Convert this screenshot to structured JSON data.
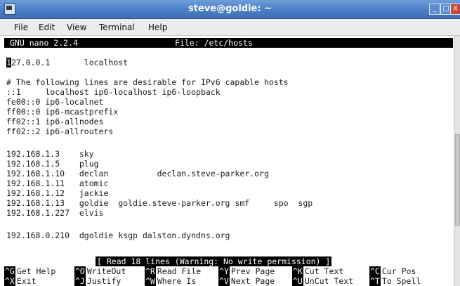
{
  "window": {
    "title": "steve@goldie: ~",
    "buttons": [
      "_",
      "□",
      "X"
    ]
  },
  "menubar": {
    "items": [
      "File",
      "Edit",
      "View",
      "Terminal",
      "Help"
    ]
  },
  "nano": {
    "version": "GNU nano 2.2.4",
    "file_label": "File: /etc/hosts",
    "cursor_char": "1",
    "lines": [
      "27.0.0.1       localhost",
      "",
      "# The following lines are desirable for IPv6 capable hosts",
      "::1     localhost ip6-localhost ip6-loopback",
      "fe00::0 ip6-localnet",
      "ff00::0 ip6-mcastprefix",
      "ff02::1 ip6-allnodes",
      "ff02::2 ip6-allrouters",
      "",
      "192.168.1.3    sky",
      "192.168.1.5    plug",
      "192.168.1.10   declan          declan.steve-parker.org",
      "192.168.1.11   atomic",
      "192.168.1.12   jackie",
      "192.168.1.13   goldie  goldie.steve-parker.org smf     spo  sgp",
      "192.168.1.227  elvis",
      "",
      "192.168.0.210  dgoldie ksgp dalston.dyndns.org"
    ],
    "status": "[ Read 18 lines (Warning: No write permission) ]",
    "shortcuts": [
      {
        "key": "^G",
        "label": "Get Help"
      },
      {
        "key": "^O",
        "label": "WriteOut"
      },
      {
        "key": "^R",
        "label": "Read File"
      },
      {
        "key": "^Y",
        "label": "Prev Page"
      },
      {
        "key": "^K",
        "label": "Cut Text"
      },
      {
        "key": "^C",
        "label": "Cur Pos"
      },
      {
        "key": "^X",
        "label": "Exit"
      },
      {
        "key": "^J",
        "label": "Justify"
      },
      {
        "key": "^W",
        "label": "Where Is"
      },
      {
        "key": "^V",
        "label": "Next Page"
      },
      {
        "key": "^U",
        "label": "UnCut Text"
      },
      {
        "key": "^T",
        "label": "To Spell"
      }
    ]
  }
}
